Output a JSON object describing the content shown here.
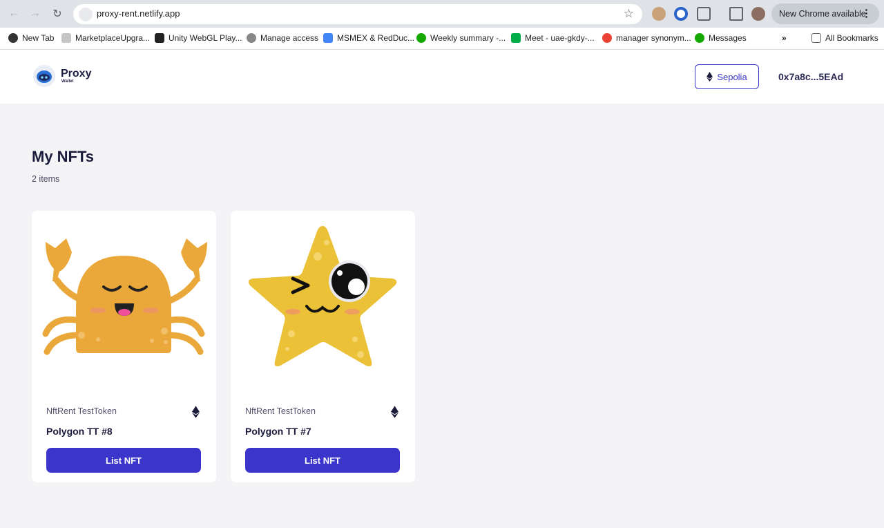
{
  "browser": {
    "url": "proxy-rent.netlify.app",
    "update_label": "New Chrome available",
    "bookmarks": [
      "New Tab",
      "MarketplaceUpgra...",
      "Unity WebGL Play...",
      "Manage access",
      "MSMEX & RedDuc...",
      "Weekly summary -...",
      "Meet - uae-gkdy-...",
      "manager synonym...",
      "Messages"
    ],
    "all_bookmarks": "All Bookmarks"
  },
  "header": {
    "logo_text": "Proxy",
    "logo_sub": "Wallet",
    "network_label": "Sepolia",
    "wallet_address": "0x7a8c...5EAd"
  },
  "page": {
    "title": "My NFTs",
    "count": "2 items"
  },
  "nfts": [
    {
      "collection": "NftRent TestToken",
      "name": "Polygon TT #8",
      "button": "List NFT",
      "art": "crab"
    },
    {
      "collection": "NftRent TestToken",
      "name": "Polygon TT #7",
      "button": "List NFT",
      "art": "starfish"
    }
  ],
  "colors": {
    "accent": "#3b35cc",
    "crab": "#eba83a",
    "star": "#ebc138"
  }
}
